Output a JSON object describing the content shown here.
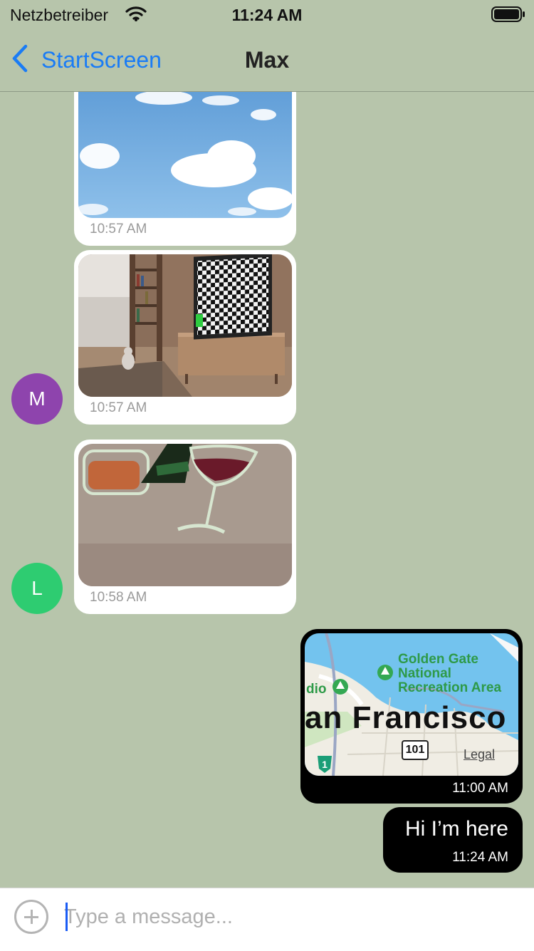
{
  "status_bar": {
    "carrier": "Netzbetreiber",
    "time": "11:24 AM",
    "wifi_icon": "wifi-icon",
    "battery_icon": "battery-icon"
  },
  "nav": {
    "back_label": "StartScreen",
    "title": "Max",
    "back_icon": "chevron-left-icon",
    "accent": "#1a7cf5"
  },
  "messages": [
    {
      "side": "incoming",
      "type": "image",
      "image": "sky-with-clouds",
      "timestamp": "10:57 AM"
    },
    {
      "side": "incoming",
      "type": "image",
      "image": "room-with-checkerboard-tv",
      "timestamp": "10:57 AM",
      "avatar": {
        "initial": "M",
        "color": "#8e44ad"
      }
    },
    {
      "side": "incoming",
      "type": "image",
      "image": "wine-glass-drawing",
      "timestamp": "10:58 AM",
      "avatar": {
        "initial": "L",
        "color": "#2ecc71"
      }
    },
    {
      "side": "outgoing",
      "type": "location",
      "map": {
        "labels": [
          "Golden Gate",
          "National",
          "Recreation Area",
          "dio",
          "an Francisco",
          "101",
          "1"
        ],
        "legal": "Legal"
      },
      "timestamp": "11:00 AM"
    },
    {
      "side": "outgoing",
      "type": "text",
      "text": "Hi I’m here",
      "timestamp": "11:24 AM"
    }
  ],
  "input": {
    "placeholder": "Type a message...",
    "add_icon": "plus-circle-icon"
  }
}
